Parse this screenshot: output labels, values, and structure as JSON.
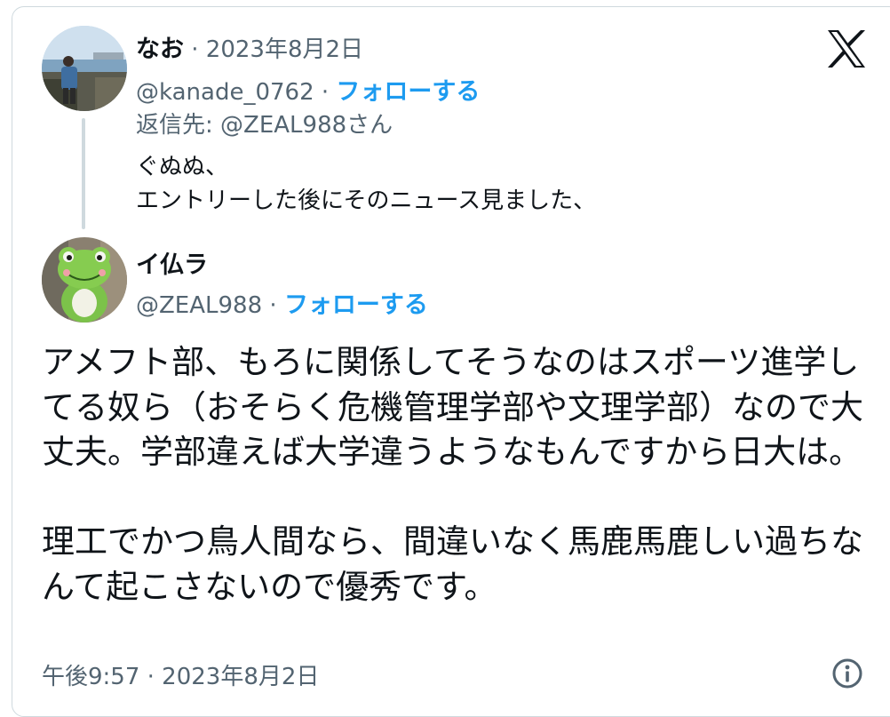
{
  "first_tweet": {
    "display_name": "なお",
    "date": " · 2023年8月2日",
    "handle": "@kanade_0762",
    "separator": " · ",
    "follow_label": "フォローする",
    "reply_to": "返信先: @ZEAL988さん",
    "text": "ぐぬぬ、\nエントリーした後にそのニュース見ました、"
  },
  "main_tweet": {
    "display_name": "イ仏ラ",
    "handle": "@ZEAL988",
    "separator": " · ",
    "follow_label": "フォローする",
    "text": "アメフト部、もろに関係してそうなのはスポーツ進学してる奴ら（おそらく危機管理学部や文理学部）なので大丈夫。学部違えば大学違うようなもんですから日大は。\n\n理工でかつ鳥人間なら、間違いなく馬鹿馬鹿しい過ちなんて起こさないので優秀です。",
    "timestamp": "午後9:57 · 2023年8月2日"
  },
  "icons": {
    "logo": "x-logo-icon",
    "info": "info-icon"
  },
  "colors": {
    "follow": "#1d9bf0",
    "secondary_text": "#536471",
    "border": "#cfd9de"
  }
}
